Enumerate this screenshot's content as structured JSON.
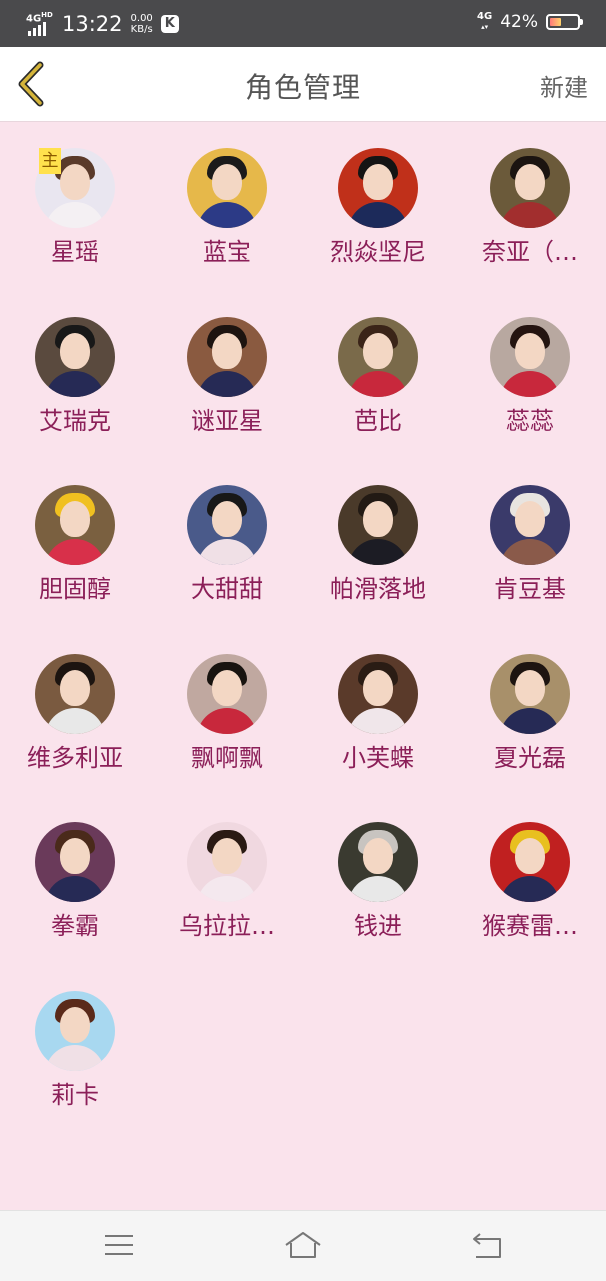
{
  "status_bar": {
    "network_left": "4G",
    "network_left_sup": "HD",
    "time": "13:22",
    "speed_value": "0.00",
    "speed_unit": "KB/s",
    "app_badge": "K",
    "network_right": "4G",
    "battery_percent": "42%",
    "battery_level": 0.42
  },
  "header": {
    "back_icon": "chevron-left-icon",
    "title": "角色管理",
    "new_label": "新建",
    "accent_color": "#c9a227"
  },
  "roles": [
    {
      "name": "星瑶",
      "main_badge": "主",
      "bg": "#e9e6f0",
      "body": "#f4f0f3",
      "hair": "#5a3a2a"
    },
    {
      "name": "蓝宝",
      "bg": "#e6b84a",
      "body": "#2c3a86",
      "hair": "#1b1b1b"
    },
    {
      "name": "烈焱坚尼",
      "bg": "#c0301a",
      "body": "#1c2a5a",
      "hair": "#141414"
    },
    {
      "name": "奈亚（…",
      "bg": "#6b5a3a",
      "body": "#a22e2e",
      "hair": "#1b1410"
    },
    {
      "name": "艾瑞克",
      "bg": "#5a4a3e",
      "body": "#262a55",
      "hair": "#181818"
    },
    {
      "name": "谜亚星",
      "bg": "#8a5a40",
      "body": "#262a55",
      "hair": "#1d1410"
    },
    {
      "name": "芭比",
      "bg": "#7a6a4a",
      "body": "#c8283c",
      "hair": "#3a2418"
    },
    {
      "name": "蕊蕊",
      "bg": "#b8a8a0",
      "body": "#c8283c",
      "hair": "#241410"
    },
    {
      "name": "胆固醇",
      "bg": "#7a6040",
      "body": "#d8304a",
      "hair": "#f0c020"
    },
    {
      "name": "大甜甜",
      "bg": "#4a5a8a",
      "body": "#f0e0e6",
      "hair": "#181818"
    },
    {
      "name": "帕滑落地",
      "bg": "#4a3a2a",
      "body": "#1c1c24",
      "hair": "#221a14"
    },
    {
      "name": "肯豆基",
      "bg": "#3a3a6a",
      "body": "#8a5a4a",
      "hair": "#e8e4e0"
    },
    {
      "name": "维多利亚",
      "bg": "#7a5a40",
      "body": "#e8e8e8",
      "hair": "#1c1410"
    },
    {
      "name": "飘啊飘",
      "bg": "#c0a8a0",
      "body": "#c8283c",
      "hair": "#181410"
    },
    {
      "name": "小芙蝶",
      "bg": "#5a3a2a",
      "body": "#f0e6ea",
      "hair": "#2a1c14"
    },
    {
      "name": "夏光磊",
      "bg": "#a8906a",
      "body": "#262a55",
      "hair": "#1d1410"
    },
    {
      "name": "拳霸",
      "bg": "#6a3a5a",
      "body": "#262a55",
      "hair": "#4a2a1a"
    },
    {
      "name": "乌拉拉…",
      "bg": "#f0d8e0",
      "body": "#f4e8ee",
      "hair": "#2a1a14"
    },
    {
      "name": "钱进",
      "bg": "#3a3a30",
      "body": "#e8e8e8",
      "hair": "#c8c4c0"
    },
    {
      "name": "猴赛雷…",
      "bg": "#c02020",
      "body": "#262a55",
      "hair": "#e8c020"
    },
    {
      "name": "莉卡",
      "bg": "#a8d8f0",
      "body": "#f0e0e6",
      "hair": "#5a2a1a"
    }
  ],
  "nav": {
    "menu_icon": "menu-icon",
    "home_icon": "home-icon",
    "back_icon": "back-icon"
  }
}
